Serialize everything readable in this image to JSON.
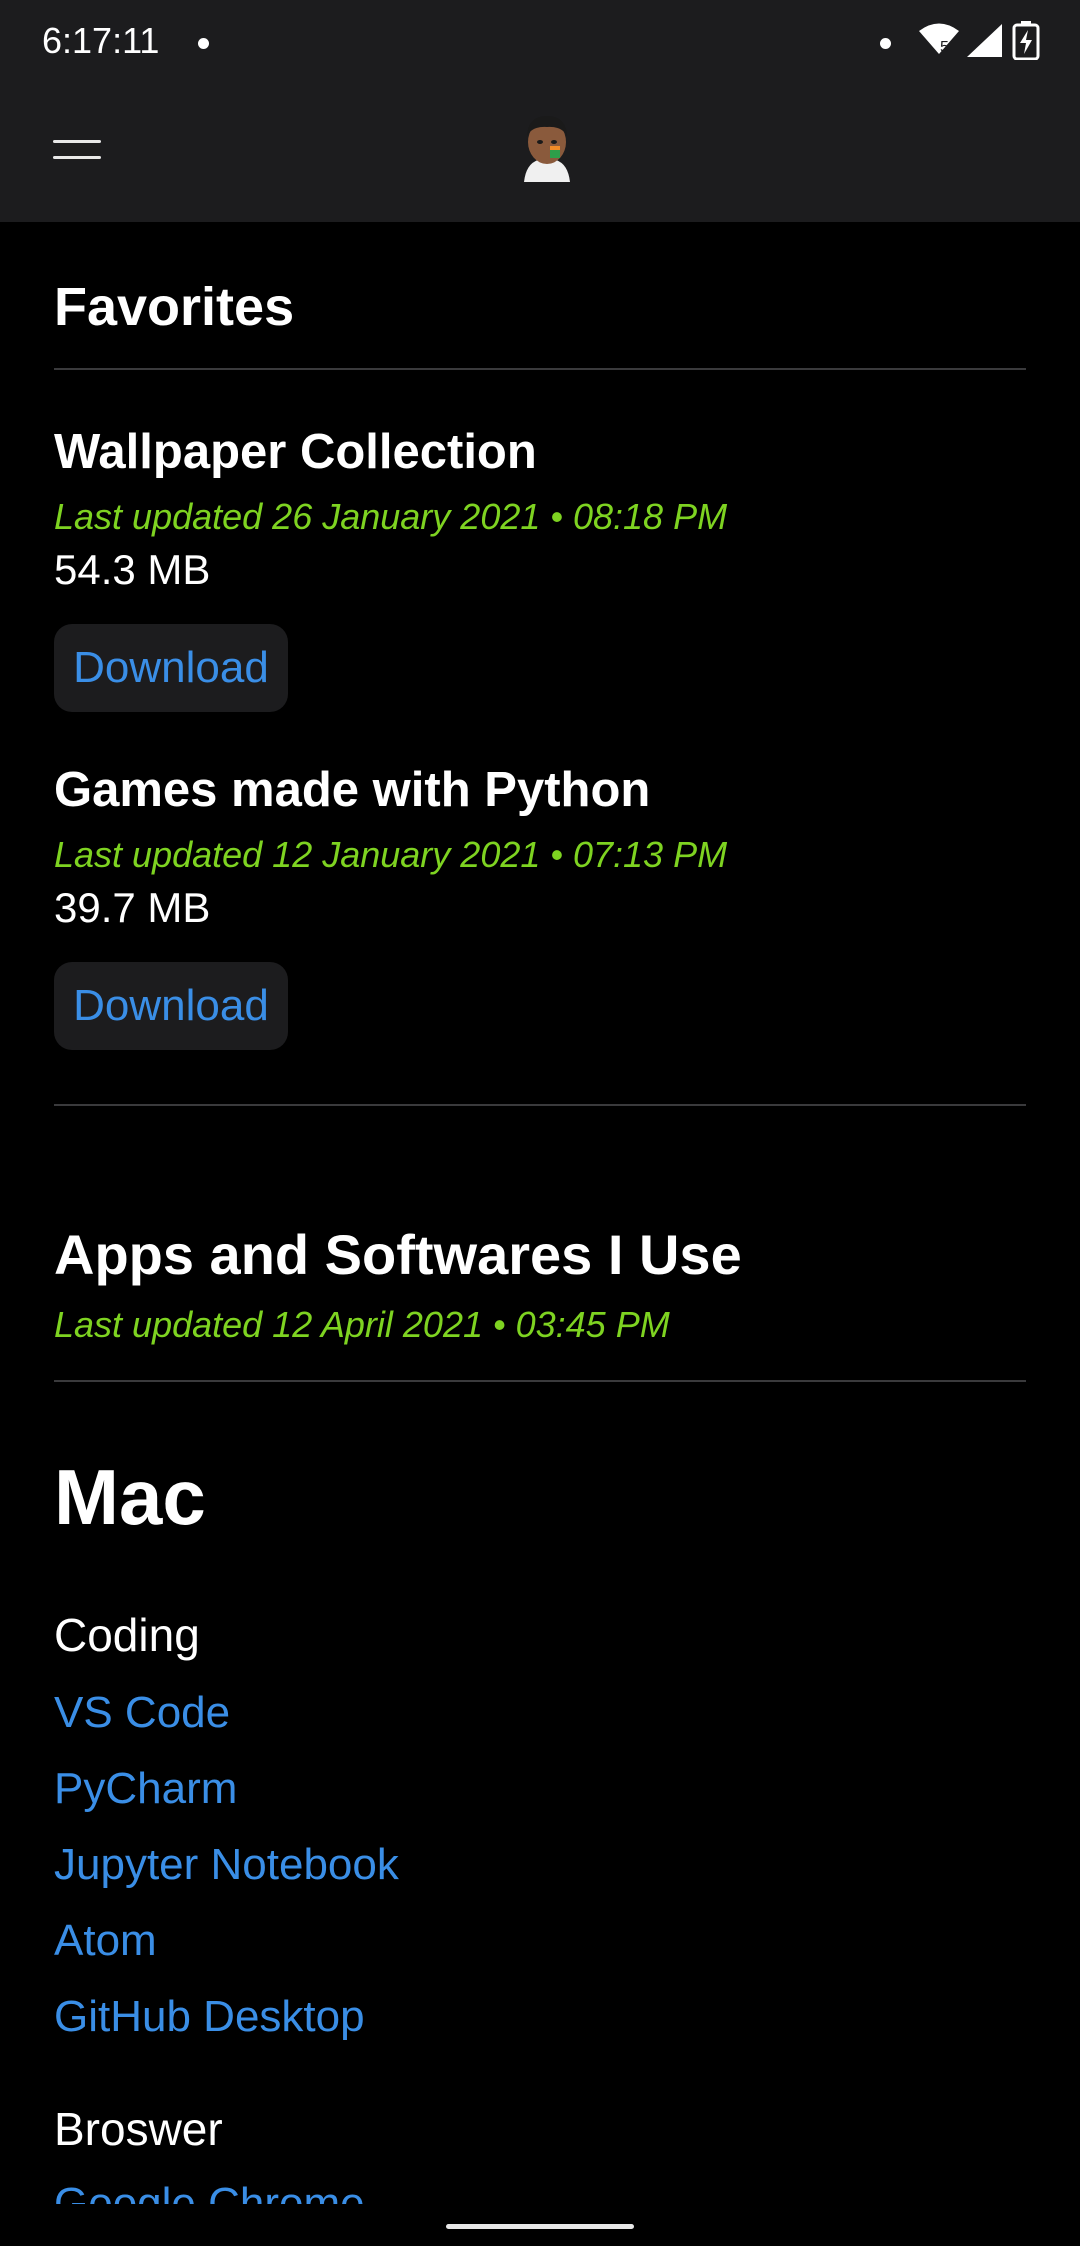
{
  "status_bar": {
    "time": "6:17:11",
    "wifi_label": "5",
    "icons": [
      "notification-dot-icon",
      "wifi-icon",
      "signal-icon",
      "battery-charging-icon"
    ]
  },
  "header": {
    "menu_icon": "hamburger-menu-icon",
    "avatar_icon": "profile-avatar"
  },
  "favorites": {
    "title": "Favorites",
    "items": [
      {
        "title": "Wallpaper Collection",
        "updated": "Last updated 26 January 2021 • 08:18 PM",
        "size": "54.3 MB",
        "button": "Download"
      },
      {
        "title": "Games made with Python",
        "updated": "Last updated 12 January 2021 • 07:13 PM",
        "size": "39.7 MB",
        "button": "Download"
      }
    ]
  },
  "apps": {
    "title": "Apps and Softwares I Use",
    "updated": "Last updated 12 April 2021 • 03:45 PM",
    "platform": "Mac",
    "categories": [
      {
        "name": "Coding",
        "links": [
          "VS Code",
          "PyCharm",
          "Jupyter Notebook",
          "Atom",
          "GitHub Desktop"
        ]
      },
      {
        "name": "Broswer",
        "links": [
          "Google Chrome"
        ]
      }
    ]
  },
  "colors": {
    "accent_link": "#3a8ee6",
    "updated_text": "#7ed321",
    "bar_background": "#1c1c1e",
    "page_background": "#000000"
  }
}
